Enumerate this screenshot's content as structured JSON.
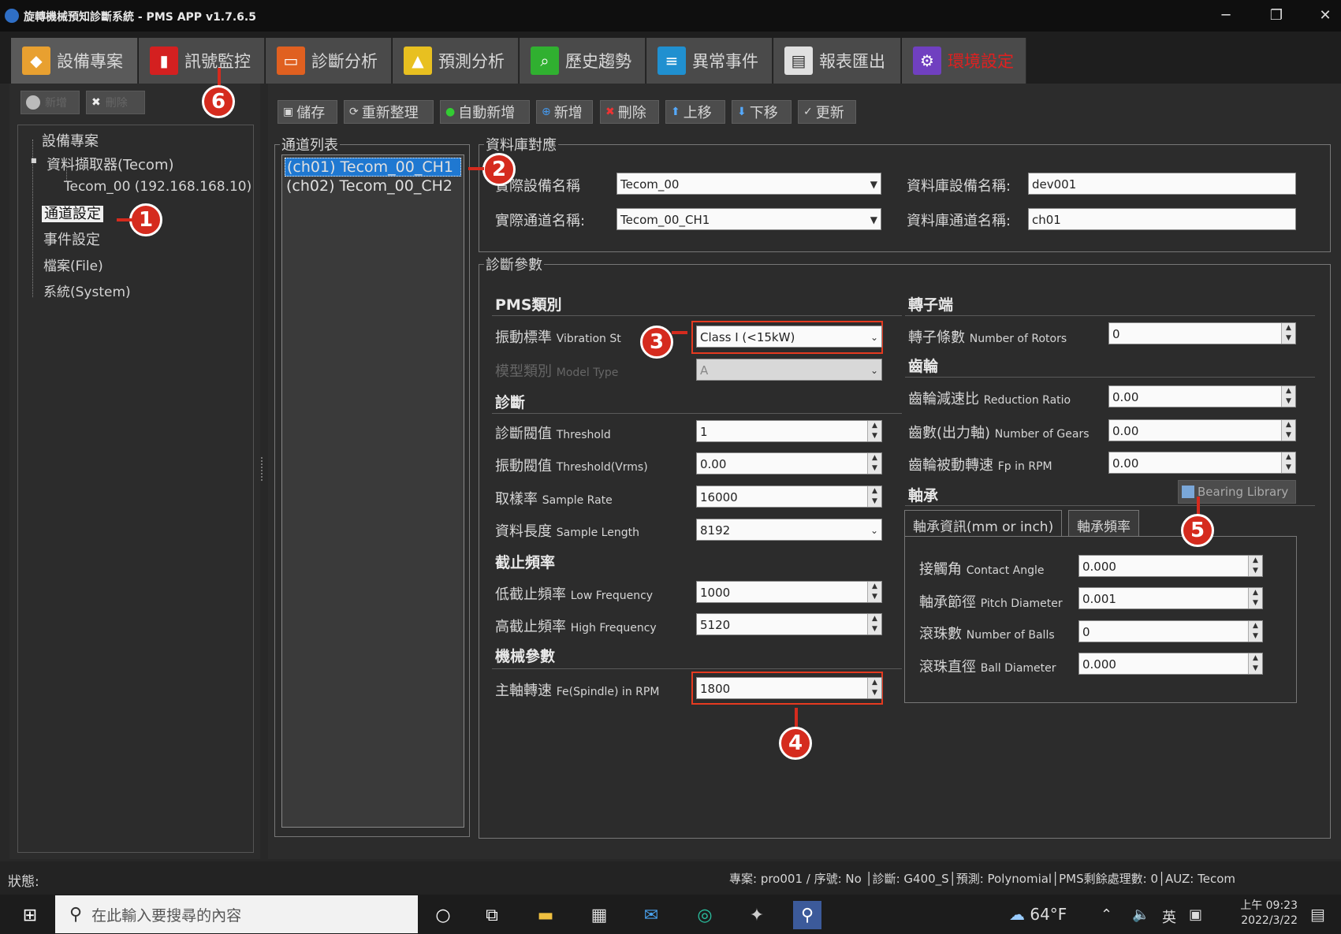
{
  "window": {
    "title": "旋轉機械預知診斷系統 - PMS APP v1.7.6.5",
    "icon": "app-icon",
    "controls": [
      "─",
      "❐",
      "✕"
    ]
  },
  "tabs": [
    {
      "label": "設備專案",
      "icon": "tag-icon",
      "color": "#e8a030"
    },
    {
      "label": "訊號監控",
      "icon": "monitor-icon",
      "color": "#d42020"
    },
    {
      "label": "診斷分析",
      "icon": "scope-icon",
      "color": "#e06020"
    },
    {
      "label": "預測分析",
      "icon": "trend-icon",
      "color": "#e8c020"
    },
    {
      "label": "歷史趨勢",
      "icon": "search-icon",
      "color": "#30b030"
    },
    {
      "label": "異常事件",
      "icon": "stack-icon",
      "color": "#2090d0"
    },
    {
      "label": "報表匯出",
      "icon": "report-icon",
      "color": "#e0e0e0"
    },
    {
      "label": "環境設定",
      "icon": "gear-icon",
      "color": "#7040c0"
    }
  ],
  "left_tools": {
    "add": "新增",
    "remove": "刪除"
  },
  "tree": {
    "root": "設備專案",
    "device": "資料擷取器(Tecom)",
    "node": "Tecom_00 (192.168.168.10)",
    "channel": "通道設定",
    "event": "事件設定",
    "file": "檔案(File)",
    "system": "系統(System)"
  },
  "toolbar": {
    "save": "儲存",
    "refresh": "重新整理",
    "autoadd": "自動新增",
    "add": "新增",
    "delete": "刪除",
    "up": "上移",
    "down": "下移",
    "update": "更新"
  },
  "channel_list": {
    "legend": "通道列表",
    "items": [
      "(ch01) Tecom_00_CH1",
      "(ch02) Tecom_00_CH2"
    ],
    "selected": 0
  },
  "db_map": {
    "legend": "資料庫對應",
    "dev_label": "實際設備名稱",
    "dev_value": "Tecom_00",
    "ch_label": "實際通道名稱:",
    "ch_value": "Tecom_00_CH1",
    "db_dev_label": "資料庫設備名稱:",
    "db_dev_value": "dev001",
    "db_ch_label": "資料庫通道名稱:",
    "db_ch_value": "ch01"
  },
  "diag": {
    "legend": "診斷參數",
    "pms_class": "PMS類別",
    "vib_label": "振動標準",
    "vib_en": "Vibration St",
    "vib_value": "Class I (<15kW)",
    "model_label": "模型類別",
    "model_en": "Model Type",
    "model_value": "A",
    "diag_sec": "診斷",
    "thr_label": "診斷閥值",
    "thr_en": "Threshold",
    "thr_value": "1",
    "vthr_label": "振動閥值",
    "vthr_en": "Threshold(Vrms)",
    "vthr_value": "0.00",
    "sr_label": "取樣率",
    "sr_en": "Sample Rate",
    "sr_value": "16000",
    "sl_label": "資料長度",
    "sl_en": "Sample Length",
    "sl_value": "8192",
    "cut_sec": "截止頻率",
    "lf_label": "低截止頻率",
    "lf_en": "Low Frequency",
    "lf_value": "1000",
    "hf_label": "高截止頻率",
    "hf_en": "High Frequency",
    "hf_value": "5120",
    "mech_sec": "機械參數",
    "rpm_label": "主軸轉速",
    "rpm_en": "Fe(Spindle) in RPM",
    "rpm_value": "1800",
    "rotor_sec": "轉子端",
    "rotors_label": "轉子條數",
    "rotors_en": "Number of Rotors",
    "rotors_value": "0",
    "gear_sec": "齒輪",
    "ratio_label": "齒輪減速比",
    "ratio_en": "Reduction Ratio",
    "ratio_value": "0.00",
    "gears_label": "齒數(出力軸)",
    "gears_en": "Number of Gears",
    "gears_value": "0.00",
    "fp_label": "齒輪被動轉速",
    "fp_en": "Fp in RPM",
    "fp_value": "0.00",
    "bearing_sec": "軸承",
    "bearing_lib": "Bearing Library",
    "btab1": "軸承資訊(mm or inch)",
    "btab2": "軸承頻率",
    "ca_label": "接觸角",
    "ca_en": "Contact Angle",
    "ca_value": "0.000",
    "pd_label": "軸承節徑",
    "pd_en": "Pitch Diameter",
    "pd_value": "0.001",
    "nb_label": "滾珠數",
    "nb_en": "Number of Balls",
    "nb_value": "0",
    "bd_label": "滾珠直徑",
    "bd_en": "Ball Diameter",
    "bd_value": "0.000"
  },
  "markers": [
    "1",
    "2",
    "3",
    "4",
    "5",
    "6"
  ],
  "status": {
    "label": "狀態:",
    "right": "專案: pro001 / 序號: No │診斷: G400_S│預測: Polynomial│PMS剩餘處理數: 0│AUZ: Tecom"
  },
  "taskbar": {
    "search_placeholder": "在此輸入要搜尋的內容",
    "weather": "64°F",
    "lang": "英",
    "time": "上午 09:23",
    "date": "2022/3/22"
  }
}
